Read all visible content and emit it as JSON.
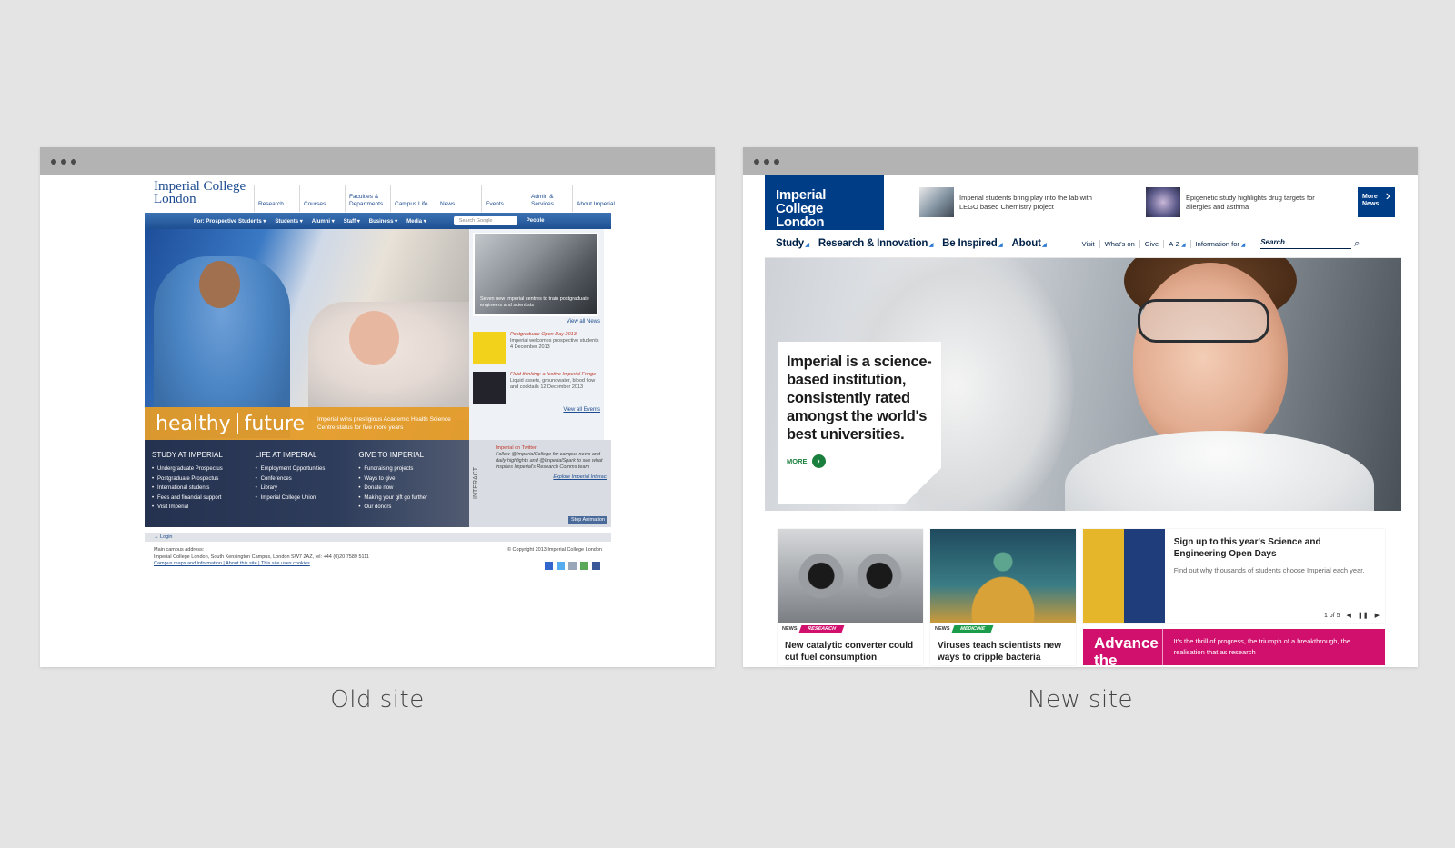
{
  "captions": {
    "old": "Old site",
    "new": "New site"
  },
  "old_site": {
    "logo": "Imperial College London",
    "topnav": [
      "Research",
      "Courses",
      "Faculties & Departments",
      "Campus Life",
      "News",
      "Events",
      "Admin & Services",
      "About Imperial"
    ],
    "bluebar": [
      "For: Prospective Students ▾",
      "Students ▾",
      "Alumni ▾",
      "Staff ▾",
      "Business ▾",
      "Media ▾"
    ],
    "search_placeholder": "Search Google",
    "people": "People",
    "hero_band_title_a": "healthy",
    "hero_band_title_b": "future",
    "hero_band_text": "Imperial wins prestigious Academic Health Science Centre status for five more years",
    "side_news_caption": "Seven new Imperial centres to train postgraduate engineers and scientists",
    "view_news": "View all News",
    "event1_title": "Postgraduate Open Day 2013",
    "event1_text": "Imperial welcomes prospective students 4 December 2013",
    "event2_title": "Fluid thinking: a festive Imperial Fringe",
    "event2_text": "Liquid assets, groundwater, blood flow and cocktails 12 December 2013",
    "view_events": "View all Events",
    "col1_title": "STUDY AT IMPERIAL",
    "col1_items": [
      "Undergraduate Prospectus",
      "Postgraduate Prospectus",
      "International students",
      "Fees and financial support",
      "Visit Imperial"
    ],
    "col2_title": "LIFE AT IMPERIAL",
    "col2_items": [
      "Employment Opportunities",
      "Conferences",
      "Library",
      "Imperial College Union"
    ],
    "col3_title": "GIVE TO IMPERIAL",
    "col3_items": [
      "Fundraising projects",
      "Ways to give",
      "Donate now",
      "Making your gift go further",
      "Our donors"
    ],
    "interact_label": "INTERACT",
    "twitter_title": "Imperial on Twitter",
    "twitter_text": "Follow @ImperialCollege for campus news and daily highlights and @ImperialSpark to see what inspires Imperial's Research Comms team",
    "explore": "Explore Imperial Interact",
    "stop_animation": "Stop Animation",
    "login": "→ Login",
    "footer_line1": "Main campus address:",
    "footer_line2": "Imperial College London, South Kensington Campus, London SW7 2AZ, tel: +44 (0)20 7589 5111",
    "footer_line3": "Campus maps and information | About this site | This site uses cookies",
    "copyright": "© Copyright 2013 Imperial College London"
  },
  "new_site": {
    "logo_line1": "Imperial College",
    "logo_line2": "London",
    "news1": "Imperial students bring play into the lab with LEGO based Chemistry project",
    "news2": "Epigenetic study highlights drug targets for allergies and asthma",
    "more_news": "More News",
    "main_nav": [
      "Study",
      "Research & Innovation",
      "Be Inspired",
      "About"
    ],
    "util_nav": [
      "Visit",
      "What's on",
      "Give",
      "A-Z",
      "Information for"
    ],
    "search_placeholder": "Search",
    "hero_text": "Imperial is a science-based institution, consistently rated amongst the world's best universities.",
    "hero_more": "MORE",
    "tile1_tag_a": "NEWS",
    "tile1_tag_b": "RESEARCH",
    "tile1_title": "New catalytic converter could cut fuel consumption",
    "tile2_tag_a": "NEWS",
    "tile2_tag_b": "MEDICINE",
    "tile2_title": "Viruses teach scientists new ways to cripple bacteria",
    "tile3_title": "Sign up to this year's Science and Engineering Open Days",
    "tile3_text": "Find out why thousands of students choose Imperial each year.",
    "tile3_pager": "1 of 5",
    "advance_title": "Advance the world",
    "advance_text": "It's the thrill of progress, the triumph of a breakthrough, the realisation that as research"
  },
  "colors": {
    "imperial_blue": "#003d87",
    "old_orange": "#e49b27",
    "research_tag": "#d1106e",
    "medicine_tag": "#1a9c4a"
  }
}
